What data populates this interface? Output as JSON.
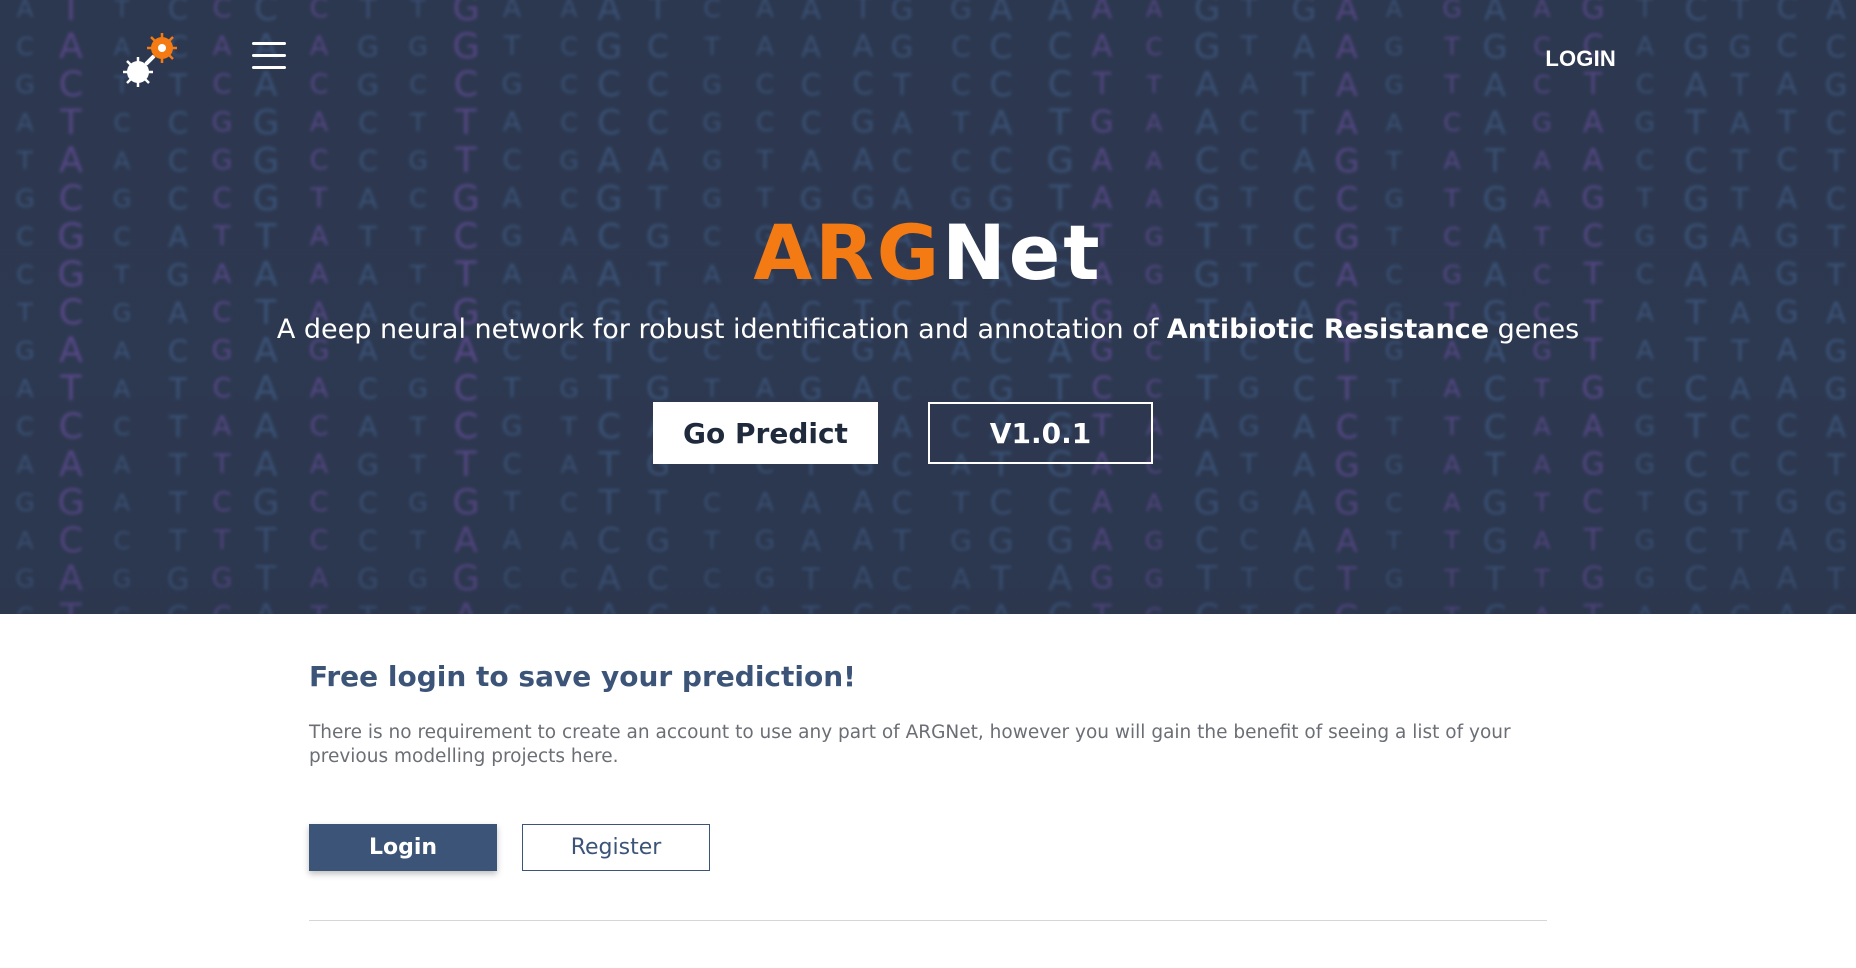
{
  "header": {
    "logo_name": "bacteria-logo",
    "menu_icon": "hamburger-menu-icon",
    "login_label": "LOGIN"
  },
  "hero": {
    "title_part1": "ARG",
    "title_part2": "Net",
    "subtitle_prefix": "A deep neural network for robust identification and annotation of ",
    "subtitle_strong": "Antibiotic Resistance",
    "subtitle_suffix": " genes",
    "predict_button": "Go Predict",
    "version_button": "V1.0.1",
    "colors": {
      "accent_orange": "#f47a14",
      "background": "#2e3a52"
    }
  },
  "login_section": {
    "title": "Free login to save your prediction!",
    "description": "There is no requirement to create an account to use any part of ARGNet, however you will gain the benefit of seeing a list of your previous modelling projects here.",
    "login_button": "Login",
    "register_button": "Register",
    "colors": {
      "primary": "#3c5478"
    }
  }
}
